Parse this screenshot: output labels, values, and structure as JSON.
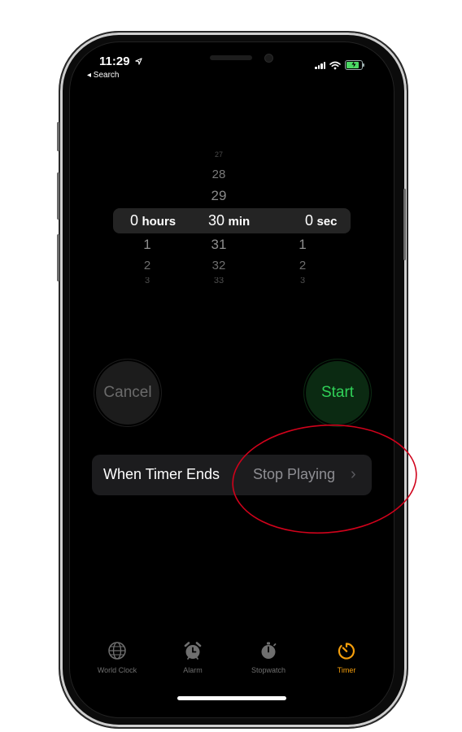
{
  "status": {
    "time": "11:29",
    "back": "◂ Search"
  },
  "picker": {
    "above": [
      {
        "min": "27"
      },
      {
        "min": "28"
      },
      {
        "min": "29"
      }
    ],
    "selected": {
      "hours": "0",
      "hours_unit": "hours",
      "min": "30",
      "min_unit": "min",
      "sec": "0",
      "sec_unit": "sec"
    },
    "below": [
      {
        "hours": "1",
        "min": "31",
        "sec": "1"
      },
      {
        "hours": "2",
        "min": "32",
        "sec": "2"
      },
      {
        "hours": "3",
        "min": "33",
        "sec": "3"
      }
    ]
  },
  "buttons": {
    "cancel": "Cancel",
    "start": "Start"
  },
  "when_timer_ends": {
    "label": "When Timer Ends",
    "value": "Stop Playing",
    "chevron": "›"
  },
  "tabs": [
    {
      "label": "World Clock",
      "icon": "globe-icon",
      "active": false
    },
    {
      "label": "Alarm",
      "icon": "alarm-clock-icon",
      "active": false
    },
    {
      "label": "Stopwatch",
      "icon": "stopwatch-icon",
      "active": false
    },
    {
      "label": "Timer",
      "icon": "timer-icon",
      "active": true
    }
  ],
  "colors": {
    "accent_orange": "#f59e0b",
    "start_green": "#30d158",
    "annotation_red": "#d0021b"
  }
}
